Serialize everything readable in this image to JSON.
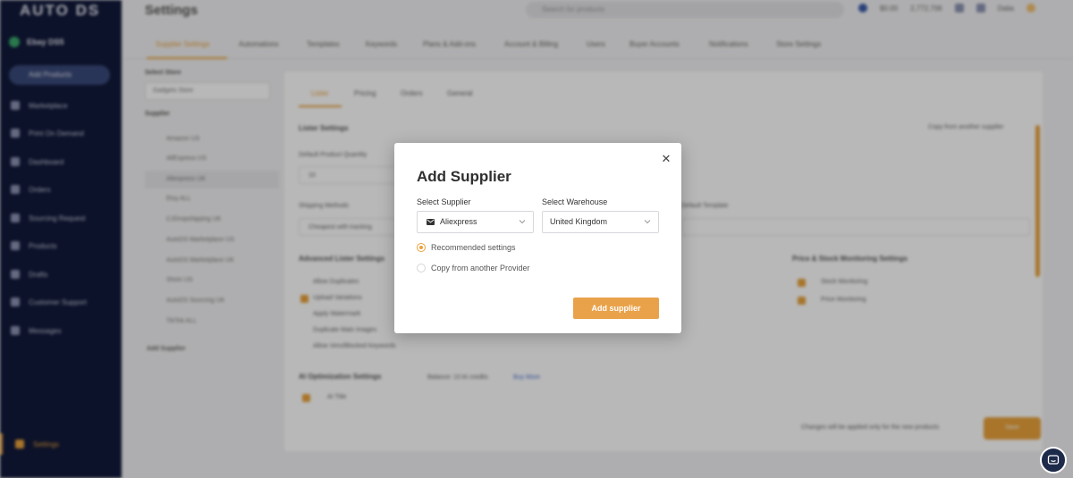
{
  "app": {
    "logo": "AUTO DS",
    "store_name": "Ebay DS5",
    "add_products": "Add Products",
    "nav": [
      {
        "label": "Marketplace"
      },
      {
        "label": "Print On Demand"
      },
      {
        "label": "Dashboard"
      },
      {
        "label": "Orders"
      },
      {
        "label": "Sourcing Request"
      },
      {
        "label": "Products"
      },
      {
        "label": "Drafts"
      },
      {
        "label": "Customer Support"
      },
      {
        "label": "Messages"
      }
    ],
    "nav_active": "Settings"
  },
  "header": {
    "title": "Settings",
    "search_placeholder": "Search for products",
    "currency": "$0.00",
    "balance": "2,772,706",
    "user": "Dalia"
  },
  "main_tabs": [
    "Supplier Settings",
    "Automations",
    "Templates",
    "Keywords",
    "Plans & Add-ons",
    "Account & Billing",
    "Users",
    "Buyer Accounts",
    "Notifications",
    "Store Settings"
  ],
  "left": {
    "select_store_label": "Select Store",
    "store_value": "Gadgets Store",
    "supplier_label": "Supplier",
    "suppliers": [
      "Amazon US",
      "AliExpress US",
      "Aliexpress UK",
      "Etsy ALL",
      "CJDropshipping UK",
      "AutoDS Marketplace US",
      "AutoDS Marketplace UK",
      "Shein US",
      "AutoDS Sourcing UK",
      "TikTok ALL"
    ],
    "add_supplier_link": "Add Supplier"
  },
  "panel": {
    "sub_tabs": [
      "Lister",
      "Pricing",
      "Orders",
      "General"
    ],
    "lister_settings": "Lister Settings",
    "copy_from_supplier": "Copy from another supplier",
    "default_qty": "Default Product Quantity",
    "qty_value": "10",
    "shipping_method": "Shipping Methods",
    "shipping_value": "Cheapest with tracking",
    "default_template": "Default Template",
    "adv_lister": "Advanced Lister Settings",
    "adv_items": [
      "Allow Duplicates",
      "Upload Variations",
      "Apply Watermark",
      "Duplicate Main Images",
      "Allow Vero/Blocked Keywords"
    ],
    "price_stock": "Price & Stock Monitoring Settings",
    "stock_mon": "Stock Monitoring",
    "price_mon": "Price Monitoring",
    "ai_title": "AI Optimization Settings",
    "ai_credits": "Balance: 10 AI credits",
    "buy_more": "Buy More",
    "ai_item": "AI Title",
    "changes_note": "Changes will be applied only for the new products",
    "save": "Save"
  },
  "modal": {
    "title": "Add Supplier",
    "select_supplier_label": "Select Supplier",
    "supplier_value": "Aliexpress",
    "select_warehouse_label": "Select Warehouse",
    "warehouse_value": "United Kingdom",
    "radio_recommended": "Recommended settings",
    "radio_copy": "Copy from another Provider",
    "add_button": "Add supplier"
  },
  "colors": {
    "accent": "#e9a24a",
    "sidebar": "#11193a"
  }
}
